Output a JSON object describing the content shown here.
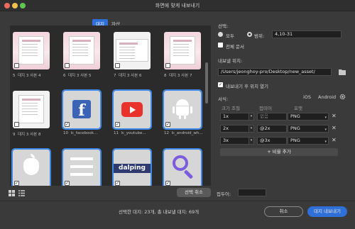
{
  "window": {
    "title": "화면에 맞게 내보내기"
  },
  "tabs": {
    "artboard": "대지",
    "asset": "자산"
  },
  "thumbs": [
    {
      "num": "5",
      "name": "대지 3 사본 4"
    },
    {
      "num": "6",
      "name": "대지 3 사본 5"
    },
    {
      "num": "7",
      "name": "대지 3 사본 6"
    },
    {
      "num": "8",
      "name": "대지 3 사본 7"
    },
    {
      "num": "9",
      "name": "대지 3 사본 8"
    },
    {
      "num": "10",
      "name": "lc_facebook..."
    },
    {
      "num": "11",
      "name": "lc_youtube..."
    },
    {
      "num": "12",
      "name": "lc_android_wh..."
    },
    {
      "dalping": "dalping"
    }
  ],
  "bottom": {
    "select_cancel": "선택 취소",
    "prefix_label": "접두어:",
    "summary": "선택한 대지: 23개, 총 내보낼 대지: 69개",
    "cancel": "취소",
    "export": "대지 내보내기"
  },
  "right": {
    "selection_label": "선택:",
    "all": "모두",
    "range": "범위:",
    "range_value": "4,10-31",
    "full_doc": "전체 문서",
    "export_to_label": "내보낼 위치:",
    "export_path": "/Users/jeonghoy-pro/Desktop/new_asset/",
    "open_location": "내보내기 후 위치 열기",
    "format_label": "서식:",
    "ios": "iOS",
    "android": "Android",
    "col_size": "크기 조절",
    "col_suffix": "접미어",
    "col_format": "포맷",
    "rows": [
      {
        "scale": "1x",
        "suffix": "없음",
        "format": "PNG"
      },
      {
        "scale": "2x",
        "suffix": "@2x",
        "format": "PNG"
      },
      {
        "scale": "3x",
        "suffix": "@3x",
        "format": "PNG"
      }
    ],
    "add_scale": "+ 비율 추가"
  }
}
